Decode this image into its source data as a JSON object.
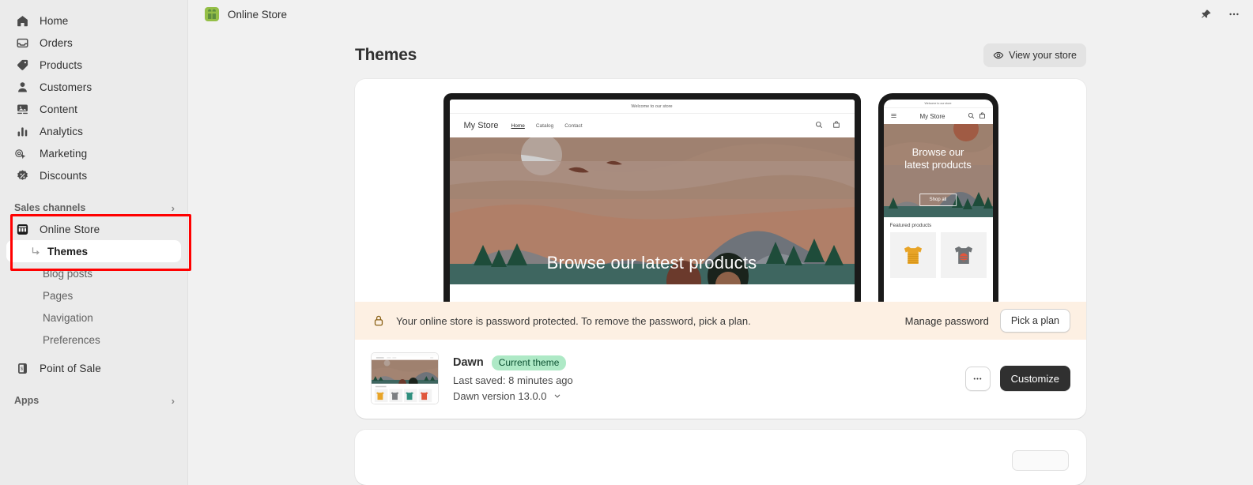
{
  "topbar": {
    "store_name": "Online Store",
    "store_icon": "shopify-store-icon",
    "pin_icon": "pin-icon",
    "more_icon": "ellipsis-icon"
  },
  "sidebar": {
    "items": [
      {
        "label": "Home",
        "icon": "home-icon"
      },
      {
        "label": "Orders",
        "icon": "orders-inbox-icon"
      },
      {
        "label": "Products",
        "icon": "product-tag-icon"
      },
      {
        "label": "Customers",
        "icon": "person-icon"
      },
      {
        "label": "Content",
        "icon": "content-image-icon"
      },
      {
        "label": "Analytics",
        "icon": "bar-chart-icon"
      },
      {
        "label": "Marketing",
        "icon": "marketing-target-icon"
      },
      {
        "label": "Discounts",
        "icon": "discount-percent-icon"
      }
    ],
    "sales_channels": {
      "label": "Sales channels",
      "chevron": "chevron-right-icon",
      "online_store": {
        "label": "Online Store",
        "icon": "storefront-icon"
      },
      "sub_items": [
        {
          "label": "Themes",
          "active": true,
          "icon": "arrow-turn-icon"
        },
        {
          "label": "Blog posts",
          "active": false
        },
        {
          "label": "Pages",
          "active": false
        },
        {
          "label": "Navigation",
          "active": false
        },
        {
          "label": "Preferences",
          "active": false
        }
      ],
      "point_of_sale": {
        "label": "Point of Sale",
        "icon": "pos-receipt-icon"
      }
    },
    "apps": {
      "label": "Apps",
      "chevron": "chevron-right-icon"
    }
  },
  "page": {
    "title": "Themes",
    "view_store": {
      "label": "View your store",
      "icon": "eye-icon"
    }
  },
  "preview": {
    "desktop": {
      "announcement": "Welcome to our store",
      "shop_name": "My Store",
      "links": [
        "Home",
        "Catalog",
        "Contact"
      ],
      "current_link": "Home",
      "search_icon": "search-icon",
      "cart_icon": "cart-icon",
      "hero_title": "Browse our latest products"
    },
    "mobile": {
      "announcement": "Welcome to our store",
      "menu_icon": "hamburger-menu-icon",
      "shop_name": "My Store",
      "search_icon": "search-icon",
      "cart_icon": "cart-icon",
      "hero_title_line1": "Browse our",
      "hero_title_line2": "latest products",
      "shop_all": "Shop all",
      "featured_heading": "Featured products",
      "product_colors": [
        "#e8a427",
        "#6f7376"
      ]
    }
  },
  "password_banner": {
    "lock_icon": "lock-icon",
    "message": "Your online store is password protected. To remove the password, pick a plan.",
    "manage_label": "Manage password",
    "plan_label": "Pick a plan",
    "background": "#fdf0e3"
  },
  "theme": {
    "name": "Dawn",
    "badge": "Current theme",
    "badge_bg": "#aee9c6",
    "last_saved": "Last saved: 8 minutes ago",
    "version": "Dawn version 13.0.0",
    "version_chevron": "chevron-down-icon",
    "more_label": "•••",
    "customize_label": "Customize",
    "thumbnail_shirt_colors": [
      "#e8a427",
      "#7c7f82",
      "#2f8f7e",
      "#e0573c"
    ]
  },
  "annotation": {
    "box_color": "#ff0000",
    "arrow_color": "#ff0000"
  }
}
